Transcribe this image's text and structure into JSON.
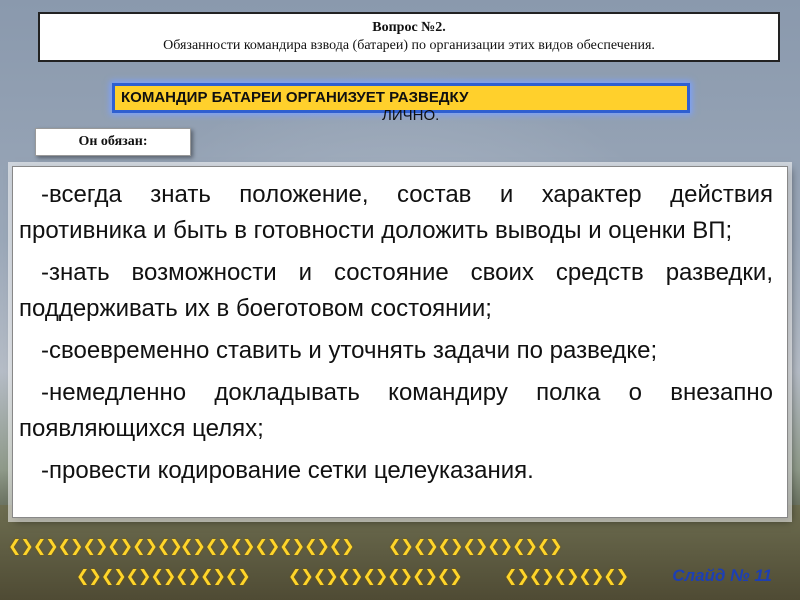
{
  "header": {
    "question": "Вопрос №2.",
    "subtitle": "Обязанности командира взвода (батареи) по организации этих видов обеспечения."
  },
  "banner": {
    "text": "КОМАНДИР БАТАРЕИ ОРГАНИЗУЕТ РАЗВЕДКУ",
    "tail": "ЛИЧНО."
  },
  "obliged_label": "Он обязан:",
  "duties": [
    "-всегда знать положение, состав и характер действия противника и быть в готовности доложить выводы и оценки ВП;",
    "-знать возможности и состояние своих средств разведки, поддерживать их в боеготовом состоянии;",
    "-своевременно ставить и уточнять задачи по разведке;",
    "-немедленно докладывать командиру полка о внезапно появляющихся целях;",
    "-провести кодирование сетки целеуказания."
  ],
  "footer": {
    "slide_label": "Слайд № 11"
  },
  "colors": {
    "banner_fill": "#ffd02c",
    "banner_border": "#2f5fd0",
    "slide_label": "#1d3fb3",
    "ornament": "#ffd52a"
  },
  "icons": [
    "ornament-border-icon"
  ]
}
